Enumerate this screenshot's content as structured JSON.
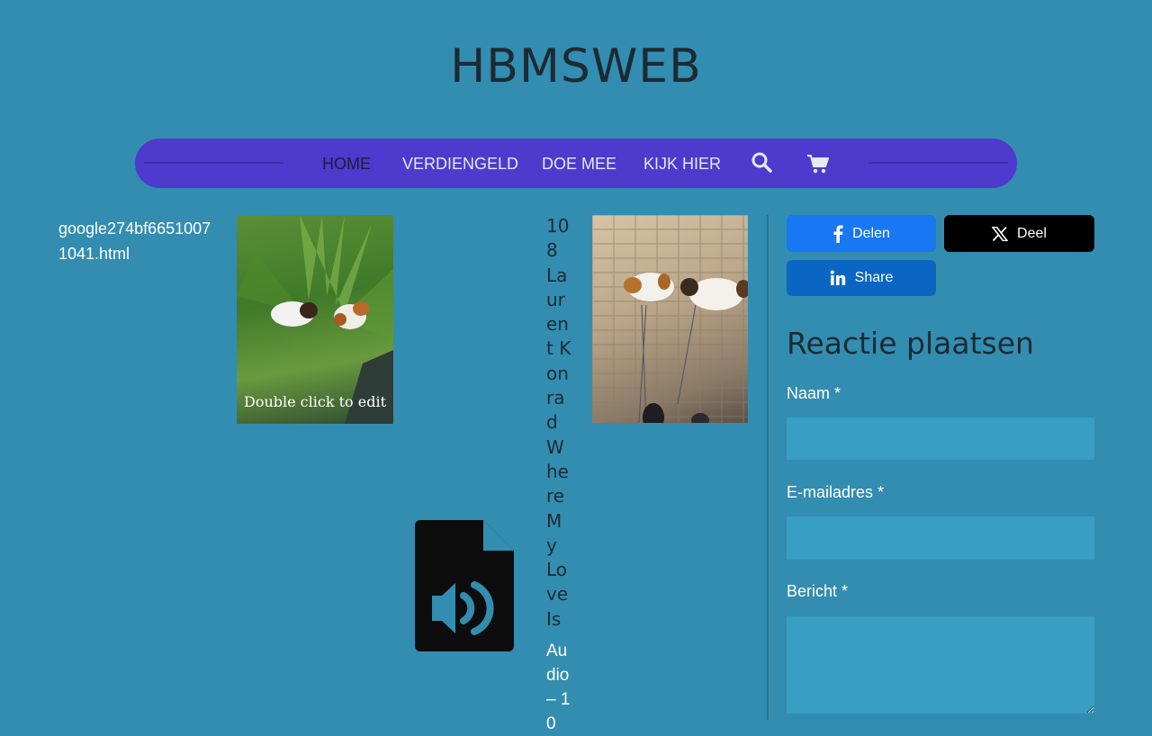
{
  "site": {
    "title": "HBMSWEB"
  },
  "nav": {
    "items": [
      {
        "label": "HOME"
      },
      {
        "label": "VERDIENGELD"
      },
      {
        "label": "DOE MEE"
      },
      {
        "label": "KIJK HIER"
      }
    ],
    "icons": [
      "search-icon",
      "cart-icon"
    ]
  },
  "content": {
    "filename": "google274bf66510071041.html",
    "image_overlay": "Double click to edit",
    "audio": {
      "title": "108 Laurent Konrad Where My Love Is",
      "subtitle": "Audio – 10"
    }
  },
  "share": {
    "facebook": "Delen",
    "x": "Deel",
    "linkedin": "Share"
  },
  "comment_form": {
    "title": "Reactie plaatsen",
    "name_label": "Naam *",
    "email_label": "E-mailadres *",
    "message_label": "Bericht *"
  },
  "colors": {
    "background": "#338db0",
    "nav": "#4e3acc",
    "field": "#389fc2",
    "facebook": "#1877f2",
    "x": "#000000",
    "linkedin": "#0a66c2"
  }
}
